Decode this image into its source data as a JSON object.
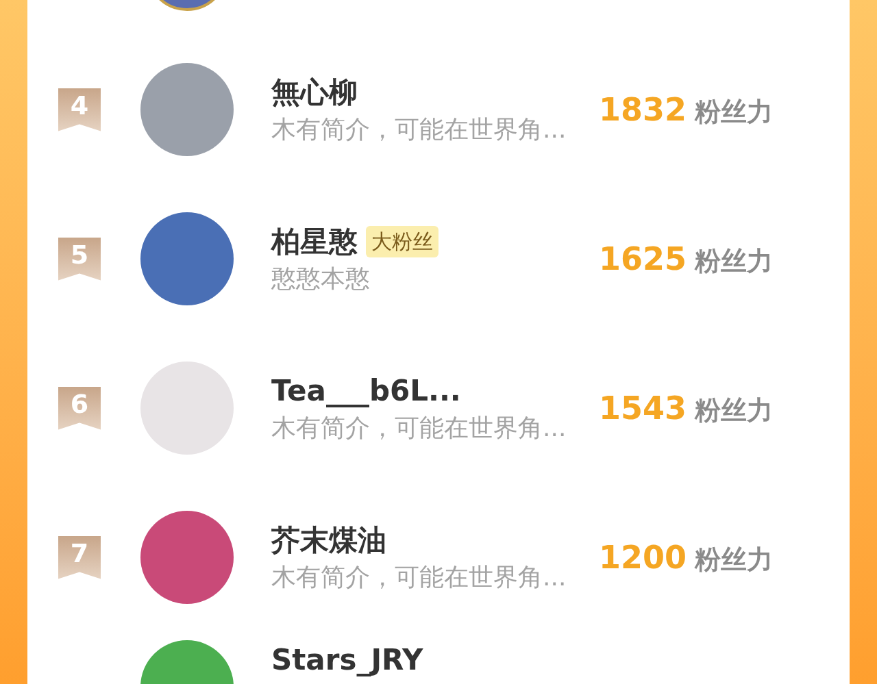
{
  "rows": [
    {
      "rank": "4",
      "name": "無心柳",
      "bio": "木有简介，可能在世界角...",
      "score": "1832",
      "score_label": "粉丝力"
    },
    {
      "rank": "5",
      "name": "柏星憨",
      "badge": "大粉丝",
      "bio": "憨憨本憨",
      "score": "1625",
      "score_label": "粉丝力"
    },
    {
      "rank": "6",
      "name": "Tea___b6L...",
      "bio": "木有简介，可能在世界角...",
      "score": "1543",
      "score_label": "粉丝力"
    },
    {
      "rank": "7",
      "name": "芥末煤油",
      "bio": "木有简介，可能在世界角...",
      "score": "1200",
      "score_label": "粉丝力"
    }
  ],
  "partial_row": {
    "name": "Stars_JRY"
  }
}
